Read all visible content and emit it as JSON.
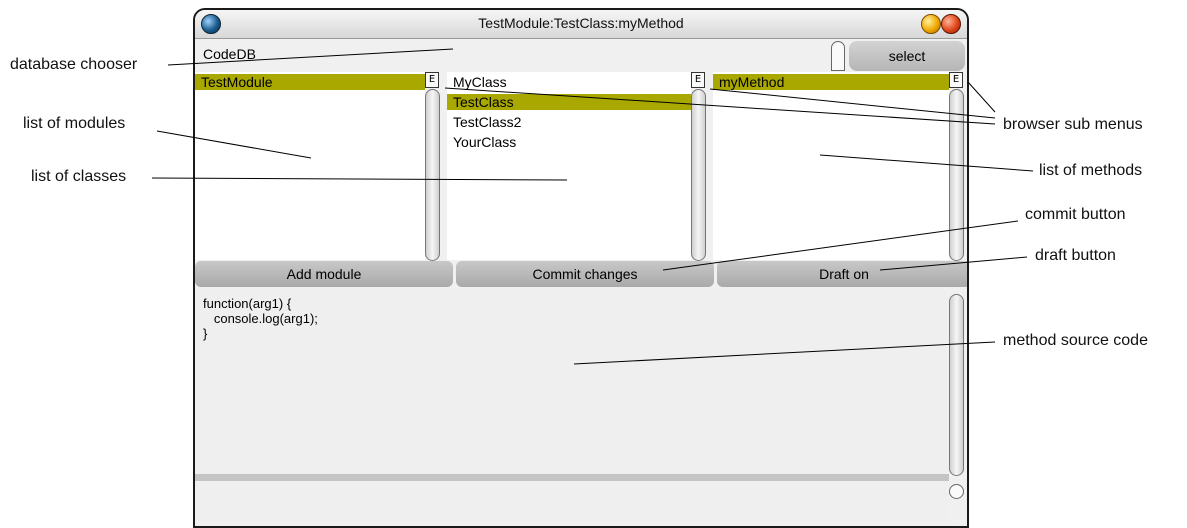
{
  "window": {
    "title": "TestModule:TestClass:myMethod"
  },
  "chooser": {
    "value": "CodeDB"
  },
  "select_button": {
    "label": "select"
  },
  "modules": {
    "items": [
      {
        "label": "TestModule",
        "selected": true
      }
    ]
  },
  "classes": {
    "items": [
      {
        "label": "MyClass",
        "selected": false
      },
      {
        "label": "TestClass",
        "selected": true
      },
      {
        "label": "TestClass2",
        "selected": false
      },
      {
        "label": "YourClass",
        "selected": false
      }
    ]
  },
  "methods": {
    "items": [
      {
        "label": "myMethod",
        "selected": true
      }
    ]
  },
  "buttons": {
    "add_module": "Add module",
    "commit": "Commit changes",
    "draft": "Draft on"
  },
  "source": {
    "lines": [
      "function(arg1) {",
      "   console.log(arg1);",
      "}"
    ]
  },
  "annotations": {
    "database_chooser": "database chooser",
    "list_of_modules": "list of modules",
    "list_of_classes": "list of classes",
    "browser_sub_menus": "browser sub menus",
    "list_of_methods": "list of methods",
    "commit_button": "commit button",
    "draft_button": "draft button",
    "method_source_code": "method source code"
  },
  "colors": {
    "selection": "#a8a800",
    "annotation_line": "#000000"
  }
}
